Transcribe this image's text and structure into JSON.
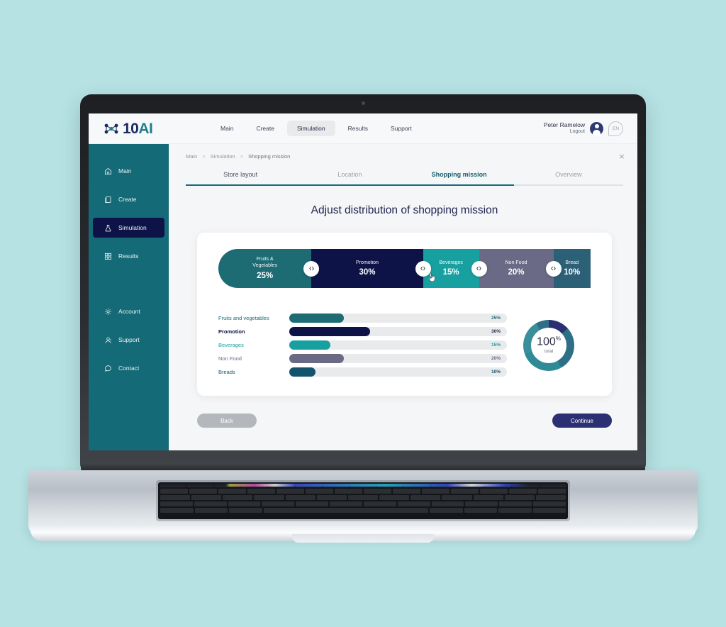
{
  "brand": {
    "part1": "10",
    "part2": "AI"
  },
  "topnav": [
    {
      "label": "Main",
      "active": false
    },
    {
      "label": "Create",
      "active": false
    },
    {
      "label": "Simulation",
      "active": true
    },
    {
      "label": "Results",
      "active": false
    },
    {
      "label": "Support",
      "active": false
    }
  ],
  "user": {
    "name": "Peter Ramelow",
    "logout": "Logout",
    "language": "EN"
  },
  "sidebar": {
    "items": [
      {
        "label": "Main",
        "icon": "home-icon",
        "active": false
      },
      {
        "label": "Create",
        "icon": "copy-icon",
        "active": false
      },
      {
        "label": "Simulation",
        "icon": "flask-icon",
        "active": true
      },
      {
        "label": "Results",
        "icon": "grid-icon",
        "active": false
      }
    ],
    "items2": [
      {
        "label": "Account",
        "icon": "gear-icon",
        "active": false
      },
      {
        "label": "Support",
        "icon": "support-agent-icon",
        "active": false
      },
      {
        "label": "Contact",
        "icon": "chat-bubble-icon",
        "active": false
      }
    ]
  },
  "breadcrumb": {
    "items": [
      "Main",
      "Simulation",
      "Shopping mission"
    ],
    "separator": ">"
  },
  "close_label": "×",
  "tabs": [
    {
      "label": "Store layout",
      "state": "done"
    },
    {
      "label": "Location",
      "state": "idle"
    },
    {
      "label": "Shopping mission",
      "state": "active"
    },
    {
      "label": "Overview",
      "state": "idle"
    }
  ],
  "progress_percent": 75,
  "page_title": "Adjust distribution of shopping mission",
  "chart_data": {
    "type": "bar",
    "title": "Adjust distribution of shopping mission",
    "categories": [
      "Fruits and vegetables",
      "Promotion",
      "Beverages",
      "Non Food",
      "Breads"
    ],
    "values": [
      25,
      30,
      15,
      20,
      10
    ],
    "value_labels": [
      "25%",
      "30%",
      "15%",
      "20%",
      "10%"
    ],
    "colors": [
      "#1d6b73",
      "#0d1346",
      "#18a0a0",
      "#6a6a86",
      "#12546b"
    ],
    "xlabel": "",
    "ylabel": "",
    "ylim": [
      0,
      100
    ],
    "unit": "%",
    "total": 100,
    "total_label": "100",
    "total_unit": "%",
    "total_sub": "total"
  },
  "segments": [
    {
      "name": "Fruits &\nVegetables",
      "value": "25%",
      "percent": 25,
      "color": "#1d6b73"
    },
    {
      "name": "Promotion",
      "value": "30%",
      "percent": 30,
      "color": "#0d1346"
    },
    {
      "name": "Beverages",
      "value": "15%",
      "percent": 15,
      "color": "#18a0a0"
    },
    {
      "name": "Non Food",
      "value": "20%",
      "percent": 20,
      "color": "#6a6a86"
    },
    {
      "name": "Bread",
      "value": "10%",
      "percent": 10,
      "color": "#2b6077"
    }
  ],
  "buttons": {
    "back": "Back",
    "continue": "Continue"
  }
}
